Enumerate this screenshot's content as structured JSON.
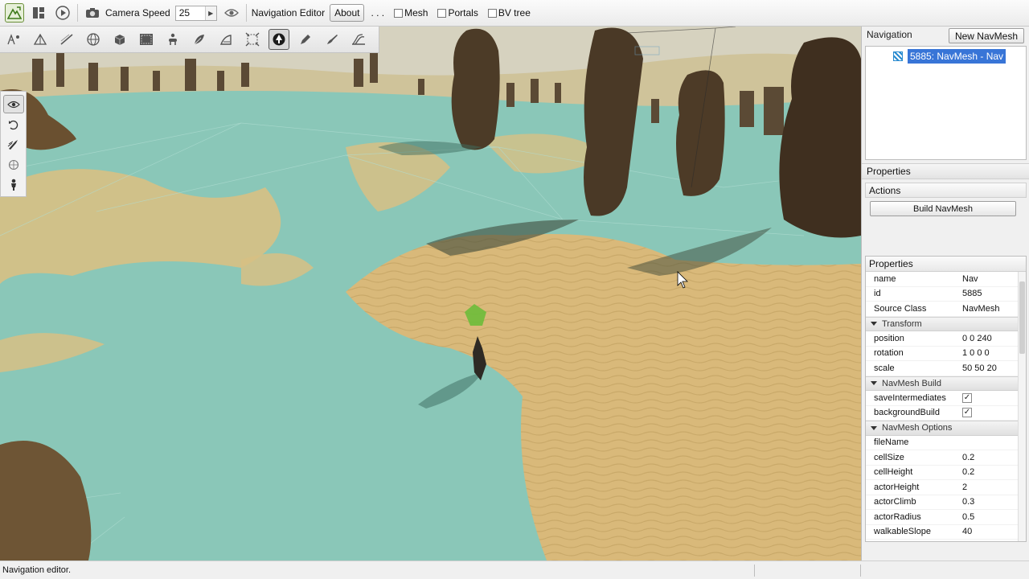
{
  "toolbar": {
    "camera_speed_label": "Camera Speed",
    "camera_speed_value": "25",
    "navigation_editor_label": "Navigation Editor",
    "about_label": "About",
    "ellipsis": ". . .",
    "mesh_label": "Mesh",
    "portals_label": "Portals",
    "bvtree_label": "BV tree",
    "mesh_checked": false,
    "portals_checked": false,
    "bvtree_checked": false
  },
  "navigation_panel": {
    "title": "Navigation",
    "new_button": "New NavMesh",
    "tree_items": [
      "5885: NavMesh - Nav"
    ]
  },
  "properties_section": {
    "title": "Properties",
    "actions_title": "Actions",
    "build_button": "Build NavMesh"
  },
  "property_grid": {
    "title": "Properties",
    "rows": [
      {
        "name": "name",
        "value": "Nav"
      },
      {
        "name": "id",
        "value": "5885"
      },
      {
        "name": "Source Class",
        "value": "NavMesh"
      }
    ],
    "transform_group": "Transform",
    "transform_rows": [
      {
        "name": "position",
        "value": "0 0 240"
      },
      {
        "name": "rotation",
        "value": "1 0 0 0"
      },
      {
        "name": "scale",
        "value": "50 50 20"
      }
    ],
    "build_group": "NavMesh Build",
    "build_rows": [
      {
        "name": "saveIntermediates",
        "checked": true
      },
      {
        "name": "backgroundBuild",
        "checked": true
      }
    ],
    "options_group": "NavMesh Options",
    "options_rows": [
      {
        "name": "fileName",
        "value": ""
      },
      {
        "name": "cellSize",
        "value": "0.2"
      },
      {
        "name": "cellHeight",
        "value": "0.2"
      },
      {
        "name": "actorHeight",
        "value": "2"
      },
      {
        "name": "actorClimb",
        "value": "0.3"
      },
      {
        "name": "actorRadius",
        "value": "0.5"
      },
      {
        "name": "walkableSlope",
        "value": "40"
      }
    ]
  },
  "status": {
    "text": "Navigation editor."
  },
  "colors": {
    "selection": "#3875d7",
    "navmesh_overlay": "#86c7b8",
    "sand": "#d8b878",
    "rock": "#4a3a28"
  }
}
